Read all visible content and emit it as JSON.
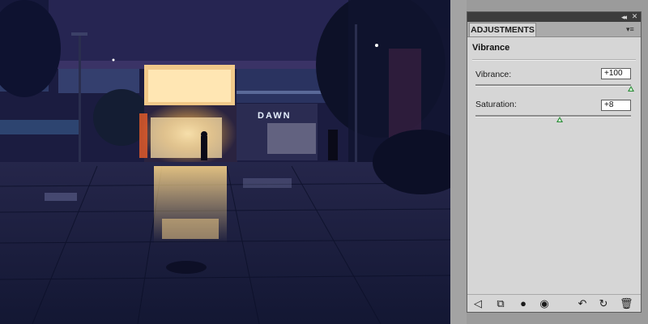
{
  "canvas": {
    "image": "night-plaza-storefront-photo",
    "sign_text": "DAWN"
  },
  "panel": {
    "tab_label": "ADJUSTMENTS",
    "title": "Vibrance",
    "controls": [
      {
        "label": "Vibrance:",
        "value": "+100",
        "slider_fraction": 1.0
      },
      {
        "label": "Saturation:",
        "value": "+8",
        "slider_fraction": 0.54
      }
    ],
    "toolbar_icons": [
      "back-arrow-icon",
      "expand-view-icon",
      "clip-to-layer-icon",
      "visibility-eye-icon",
      "view-previous-state-icon",
      "reset-icon",
      "delete-trash-icon"
    ]
  },
  "colors": {
    "panel_bg": "#d6d6d6",
    "slider_thumb": "#2d8a3a"
  }
}
